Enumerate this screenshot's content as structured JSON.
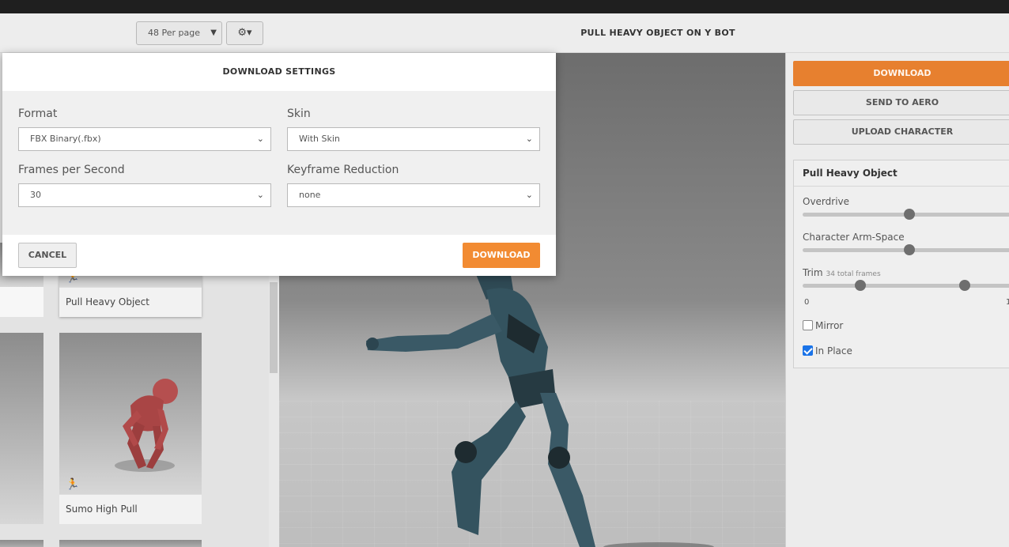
{
  "toolbar": {
    "per_page": "48 Per page",
    "gear_icon": "gear-icon"
  },
  "viewport": {
    "title": "PULL HEAVY OBJECT ON Y BOT"
  },
  "library": {
    "cards": [
      {
        "label": "Pull Heavy Object"
      },
      {
        "label": "Sumo High Pull"
      }
    ]
  },
  "actions": {
    "download": "DOWNLOAD",
    "send_to_aero": "SEND TO AERO",
    "upload_character": "UPLOAD CHARACTER"
  },
  "settings": {
    "title": "Pull Heavy Object",
    "overdrive_label": "Overdrive",
    "overdrive_value": 0.5,
    "arm_space_label": "Character Arm-Space",
    "arm_space_value": 0.5,
    "trim_label": "Trim",
    "trim_note": "34 total frames",
    "trim_start_tick": "0",
    "trim_end_tick": "1",
    "mirror_label": "Mirror",
    "mirror_checked": false,
    "in_place_label": "In Place",
    "in_place_checked": true
  },
  "modal": {
    "title": "DOWNLOAD SETTINGS",
    "format_label": "Format",
    "format_value": "FBX Binary(.fbx)",
    "skin_label": "Skin",
    "skin_value": "With Skin",
    "fps_label": "Frames per Second",
    "fps_value": "30",
    "keyframe_label": "Keyframe Reduction",
    "keyframe_value": "none",
    "cancel": "CANCEL",
    "download": "DOWNLOAD"
  },
  "colors": {
    "accent_orange": "#e7802f",
    "button_orange": "#f28b32",
    "checkbox_blue": "#1a73e8"
  }
}
